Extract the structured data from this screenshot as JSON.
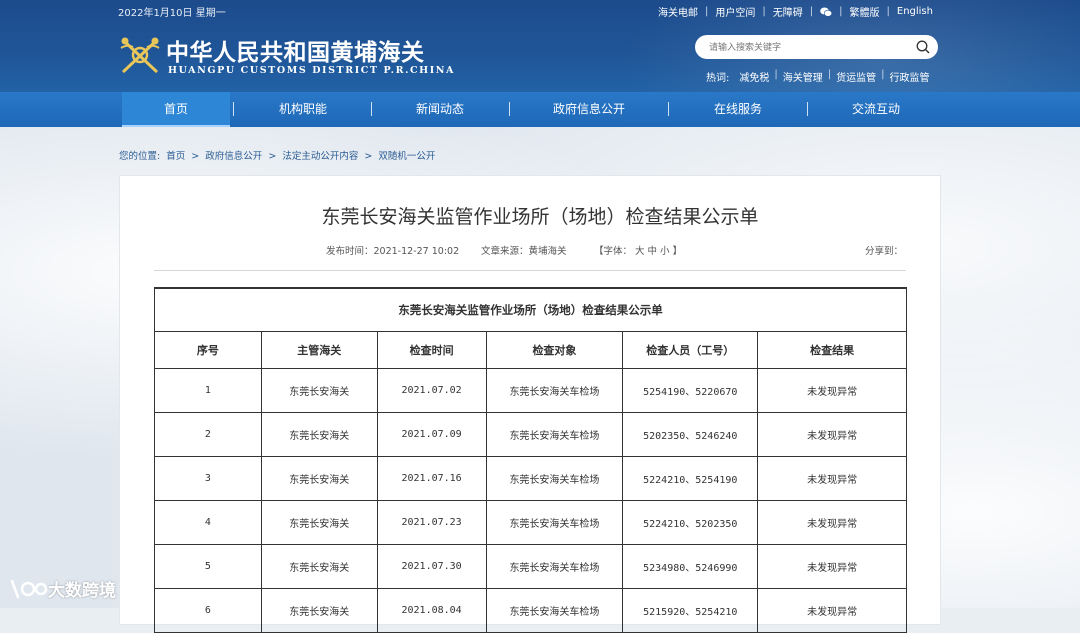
{
  "topbar": {
    "date": "2022年1月10日 星期一",
    "links": [
      "海关电邮",
      "用户空间",
      "无障碍",
      "繁體版",
      "English"
    ]
  },
  "brand": {
    "cn": "中华人民共和国黄埔海关",
    "en": "HUANGPU CUSTOMS DISTRICT P.R.CHINA"
  },
  "search": {
    "placeholder": "请输入搜索关键字"
  },
  "hot": {
    "label": "热词:",
    "items": [
      "减免税",
      "海关管理",
      "货运监管",
      "行政监管"
    ]
  },
  "nav": [
    "首页",
    "机构职能",
    "新闻动态",
    "政府信息公开",
    "在线服务",
    "交流互动"
  ],
  "breadcrumb": [
    "您的位置:",
    "首页",
    ">",
    "政府信息公开",
    ">",
    "法定主动公开内容",
    ">",
    "双随机一公开"
  ],
  "article": {
    "title": "东莞长安海关监管作业场所（场地）检查结果公示单",
    "publish": "发布时间：2021-12-27 10:02",
    "source": "文章来源：黄埔海关",
    "fontsize": "【字体： 大 中 小 】",
    "share": "分享到："
  },
  "table": {
    "caption": "东莞长安海关监管作业场所（场地）检查结果公示单",
    "headers": [
      "序号",
      "主管海关",
      "检查时间",
      "检查对象",
      "检查人员（工号）",
      "检查结果"
    ],
    "rows": [
      [
        "1",
        "东莞长安海关",
        "2021.07.02",
        "东莞长安海关车检场",
        "5254190、5220670",
        "未发现异常"
      ],
      [
        "2",
        "东莞长安海关",
        "2021.07.09",
        "东莞长安海关车检场",
        "5202350、5246240",
        "未发现异常"
      ],
      [
        "3",
        "东莞长安海关",
        "2021.07.16",
        "东莞长安海关车检场",
        "5224210、5254190",
        "未发现异常"
      ],
      [
        "4",
        "东莞长安海关",
        "2021.07.23",
        "东莞长安海关车检场",
        "5224210、5202350",
        "未发现异常"
      ],
      [
        "5",
        "东莞长安海关",
        "2021.07.30",
        "东莞长安海关车检场",
        "5234980、5246990",
        "未发现异常"
      ],
      [
        "6",
        "东莞长安海关",
        "2021.08.04",
        "东莞长安海关车检场",
        "5215920、5254210",
        "未发现异常"
      ]
    ]
  },
  "watermark": "大数跨境"
}
